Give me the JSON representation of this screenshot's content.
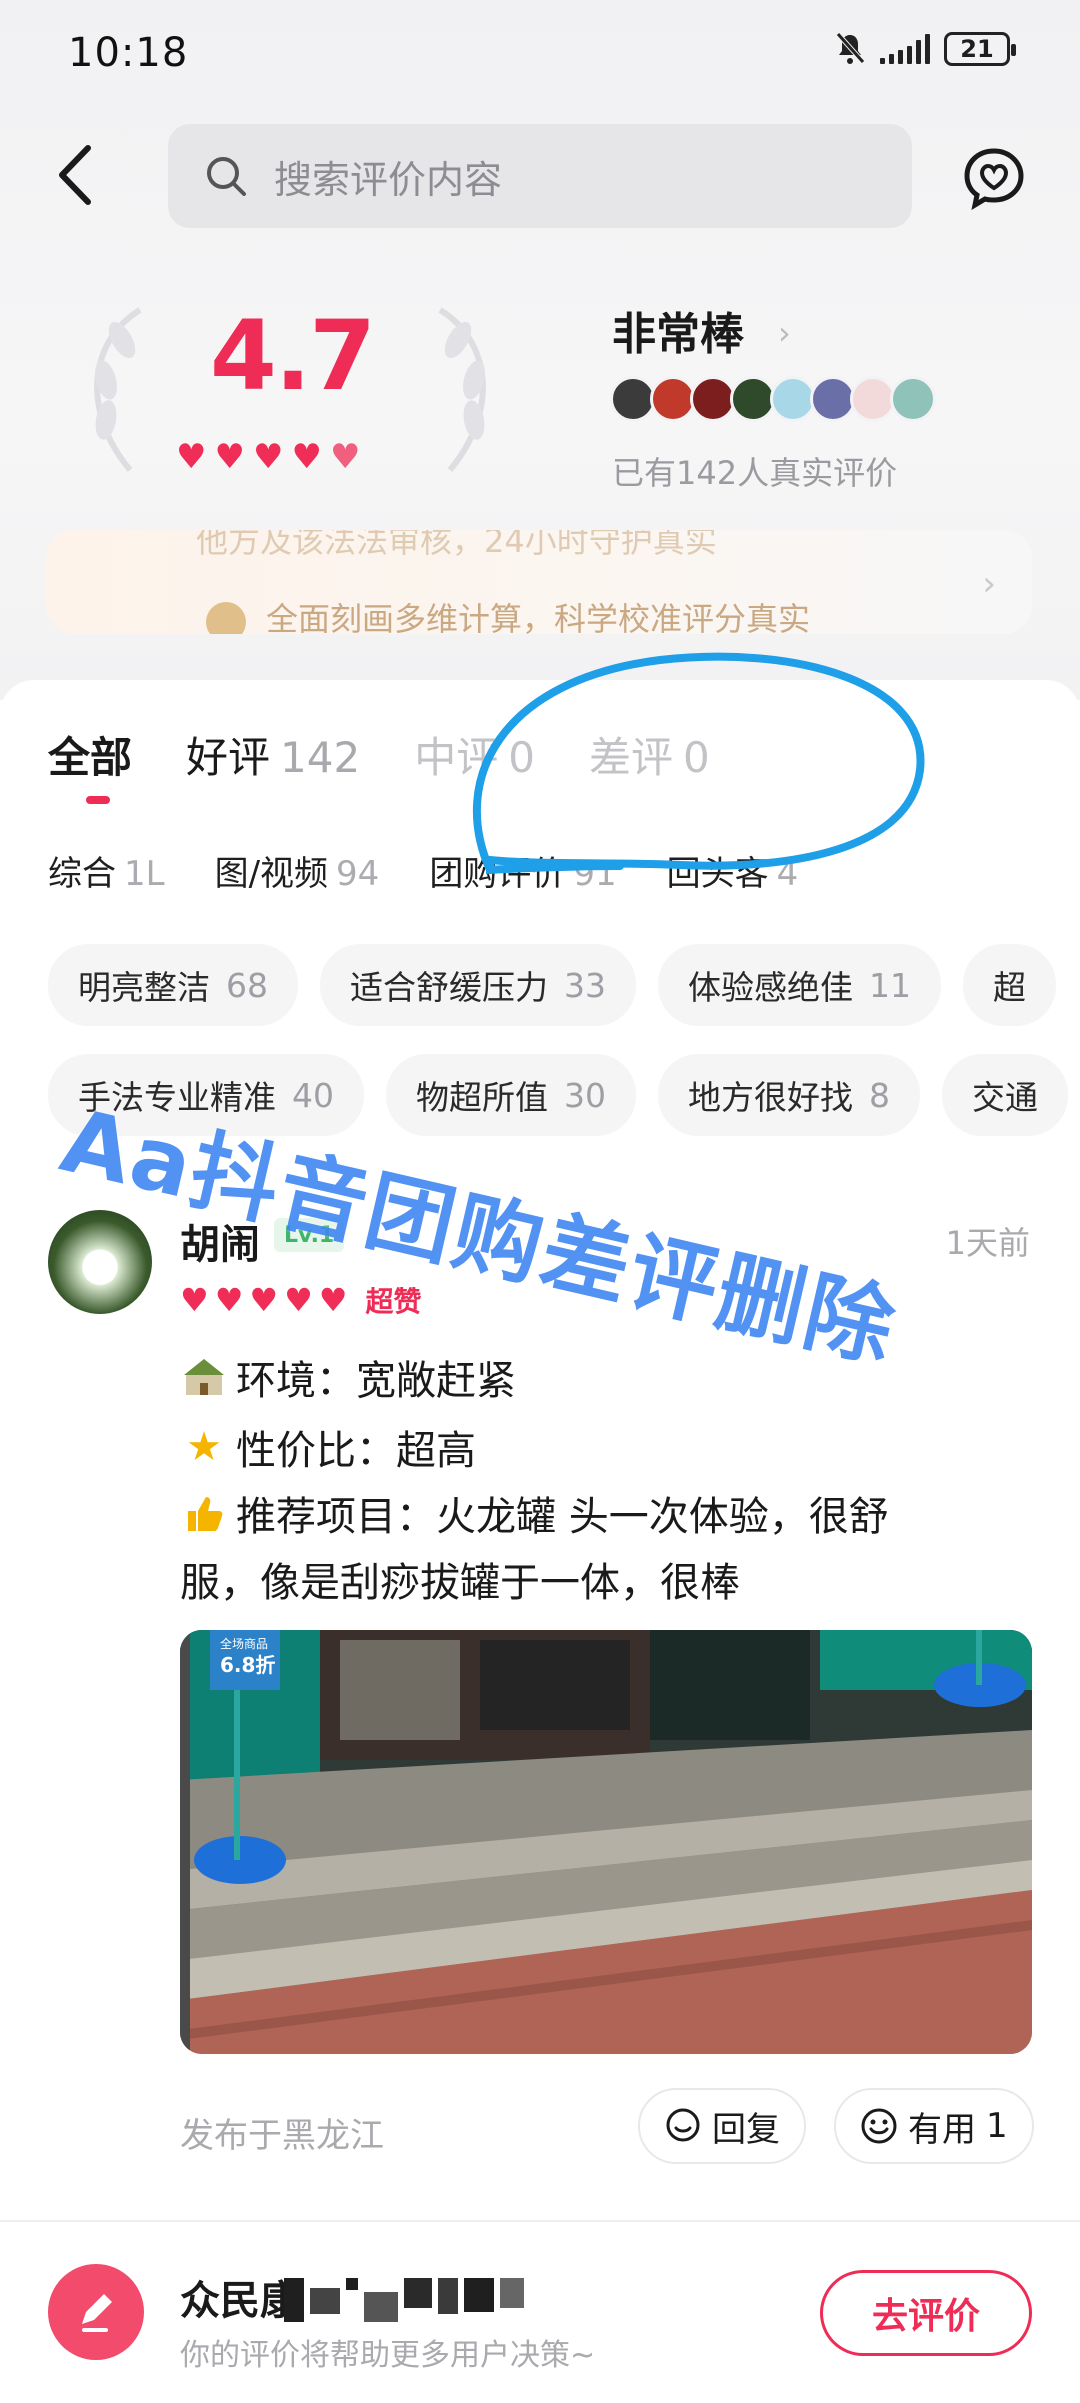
{
  "status_bar": {
    "time": "10:18",
    "battery": "21"
  },
  "search": {
    "placeholder": "搜索评价内容"
  },
  "rating": {
    "score": "4.7",
    "label": "非常棒",
    "count_text": "已有142人真实评价"
  },
  "info_card": {
    "line1": "他方及该法法审核，24小时守护真实",
    "line2": "全面刻画多维计算，科学校准评分真实"
  },
  "tabs": [
    {
      "label": "全部",
      "count": ""
    },
    {
      "label": "好评",
      "count": "142"
    },
    {
      "label": "中评",
      "count": "0"
    },
    {
      "label": "差评",
      "count": "0"
    }
  ],
  "subtabs": [
    {
      "label": "综合",
      "count": "1L"
    },
    {
      "label": "图/视频",
      "count": "94"
    },
    {
      "label": "团购评价",
      "count": "91"
    },
    {
      "label": "回头客",
      "count": "4"
    }
  ],
  "chips_row1": [
    {
      "label": "明亮整洁",
      "count": "68"
    },
    {
      "label": "适合舒缓压力",
      "count": "33"
    },
    {
      "label": "体验感绝佳",
      "count": "11"
    },
    {
      "label": "超",
      "count": ""
    }
  ],
  "chips_row2": [
    {
      "label": "手法专业精准",
      "count": "40"
    },
    {
      "label": "物超所值",
      "count": "30"
    },
    {
      "label": "地方很好找",
      "count": "8"
    },
    {
      "label": "交通",
      "count": ""
    }
  ],
  "review": {
    "user": "胡闹",
    "level": "Lv.1",
    "time": "1天前",
    "tag": "超赞",
    "lines": [
      "环境：宽敞赶紧",
      "性价比：超高",
      "推荐项目：火龙罐 头一次体验，很舒",
      "服，像是刮痧拔罐于一体，很棒"
    ],
    "photo_banner": {
      "line1": "全场商品",
      "line2": "6.8折"
    },
    "location": "发布于黑龙江",
    "reply_label": "回复",
    "useful_label": "有用",
    "useful_count": "1"
  },
  "bottom": {
    "name": "众民康",
    "subtitle": "你的评价将帮助更多用户决策~",
    "write_button": "去评价"
  },
  "watermark": "Aa抖音团购差评删除",
  "colors": {
    "accent": "#ee2c55",
    "watermark": "#3f87f2",
    "level_badge": "#3db56c"
  }
}
